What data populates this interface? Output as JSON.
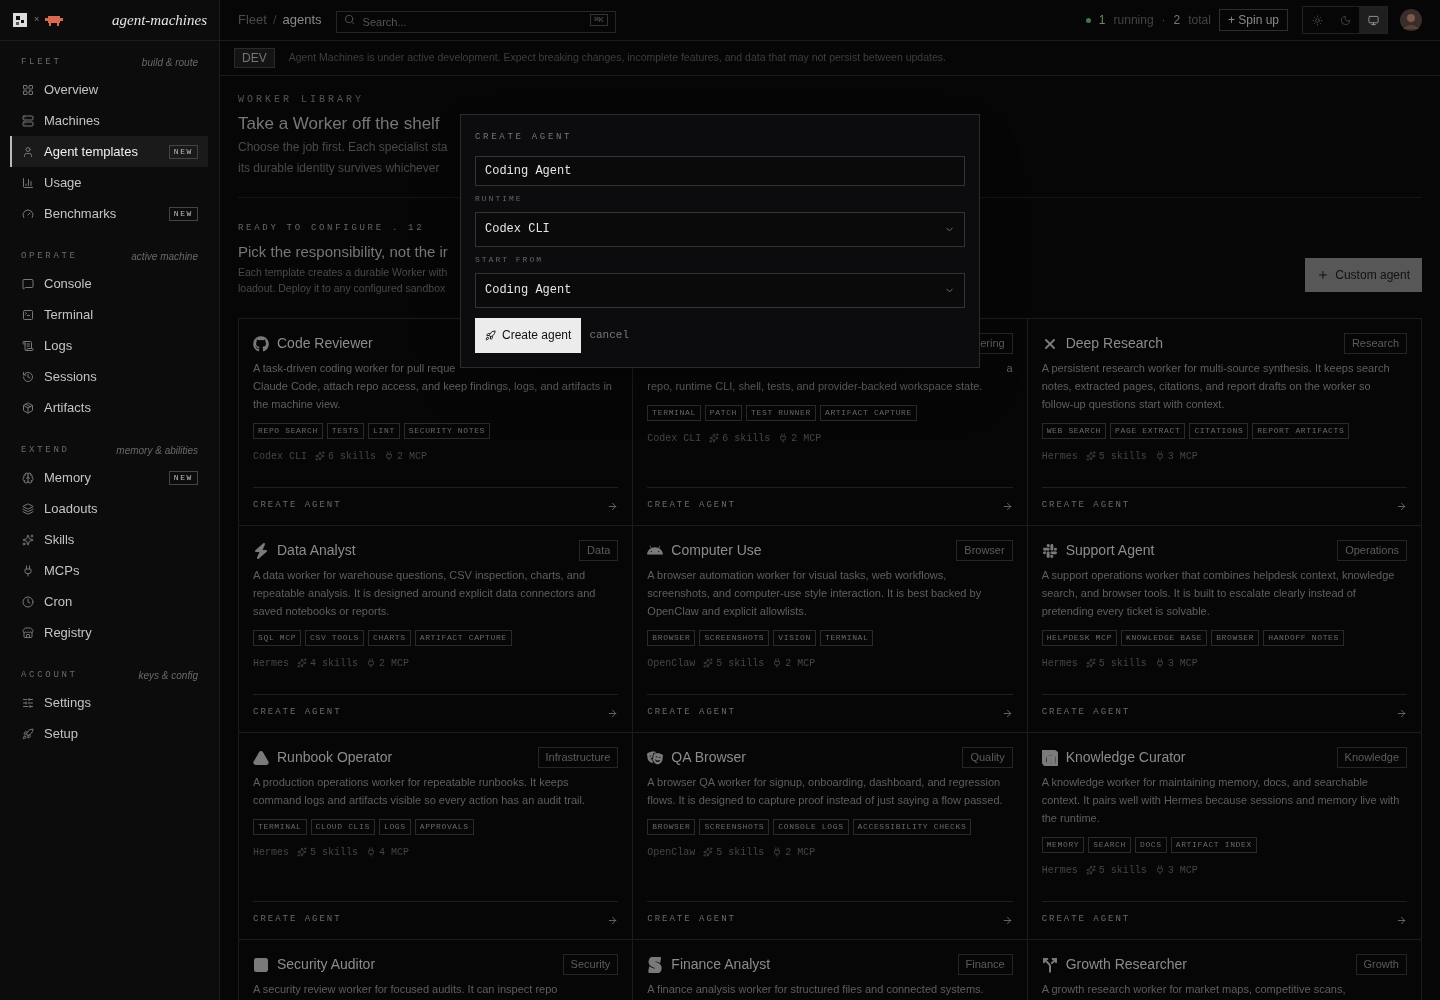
{
  "brand": {
    "separator": "×",
    "name": "agent-machines"
  },
  "breadcrumb": [
    "Fleet",
    "/",
    "agents"
  ],
  "search": {
    "placeholder": "Search...",
    "shortcut": "⌘K"
  },
  "status": {
    "running_count": "1",
    "running_label": "running",
    "dot": "·",
    "total_count": "2",
    "total_label": "total"
  },
  "spin_up_button": "+ Spin up",
  "theme_buttons": [
    {
      "kind": "light",
      "selected": false
    },
    {
      "kind": "dark",
      "selected": false
    },
    {
      "kind": "system",
      "selected": true
    }
  ],
  "sidebar": [
    {
      "label": "FLEET",
      "hint": "build & route",
      "items": [
        {
          "label": "Overview",
          "selected": false
        },
        {
          "label": "Machines",
          "selected": false
        },
        {
          "label": "Agent templates",
          "selected": true,
          "badge": "NEW"
        },
        {
          "label": "Usage",
          "selected": false
        },
        {
          "label": "Benchmarks",
          "selected": false,
          "badge": "NEW"
        }
      ]
    },
    {
      "label": "OPERATE",
      "hint": "active machine",
      "items": [
        {
          "label": "Console",
          "selected": false
        },
        {
          "label": "Terminal",
          "selected": false
        },
        {
          "label": "Logs",
          "selected": false
        },
        {
          "label": "Sessions",
          "selected": false
        },
        {
          "label": "Artifacts",
          "selected": false
        }
      ]
    },
    {
      "label": "EXTEND",
      "hint": "memory & abilities",
      "items": [
        {
          "label": "Memory",
          "selected": false,
          "badge": "NEW"
        },
        {
          "label": "Loadouts",
          "selected": false
        },
        {
          "label": "Skills",
          "selected": false
        },
        {
          "label": "MCPs",
          "selected": false
        },
        {
          "label": "Cron",
          "selected": false
        },
        {
          "label": "Registry",
          "selected": false
        }
      ]
    },
    {
      "label": "ACCOUNT",
      "hint": "keys & config",
      "items": [
        {
          "label": "Settings",
          "selected": false
        },
        {
          "label": "Setup",
          "selected": false
        }
      ]
    }
  ],
  "banner": {
    "badge": "DEV",
    "text": "Agent Machines is under active development. Expect breaking changes, incomplete features, and data that may not persist between updates."
  },
  "library": {
    "eyebrow": "WORKER LIBRARY",
    "title": "Take a Worker off the shelf",
    "lines": [
      "Choose the job first. Each specialist sta",
      "its durable identity survives whichever"
    ]
  },
  "section": {
    "eyebrow": "READY TO CONFIGURE . 12",
    "title": "Pick the responsibility, not the ir",
    "lines": [
      "Each template creates a durable Worker with",
      "loadout. Deploy it to any configured sandbox"
    ],
    "button": "Custom agent"
  },
  "cards": [
    {
      "title": "Code Reviewer",
      "description": [
        {
          "kind": "full",
          "text": "A task-driven coding worker for pull reque"
        },
        {
          "kind": "full",
          "text": "Claude Code, attach repo access, and keep findings, logs, and artifacts in"
        },
        {
          "kind": "full",
          "text": "the machine view."
        }
      ],
      "tags": [
        "REPO SEARCH",
        "TESTS",
        "LINT",
        "SECURITY NOTES"
      ],
      "runtime": "Codex CLI",
      "skills": "6 skills",
      "mcp": "2 MCP",
      "action": "CREATE AGENT"
    },
    {
      "badge": "ering",
      "description": [
        {
          "kind": "tail",
          "text": "a"
        },
        {
          "kind": "full",
          "text": "repo, runtime CLI, shell, tests, and provider-backed workspace state."
        }
      ],
      "tags": [
        "TERMINAL",
        "PATCH",
        "TEST RUNNER",
        "ARTIFACT CAPTURE"
      ],
      "runtime": "Codex CLI",
      "skills": "6 skills",
      "mcp": "2 MCP",
      "action": "CREATE AGENT"
    },
    {
      "title": "Deep Research",
      "badge": "Research",
      "description": "A persistent research worker for multi-source synthesis. It keeps search notes, extracted pages, citations, and report drafts on the worker so follow-up questions start with context.",
      "tags": [
        "WEB SEARCH",
        "PAGE EXTRACT",
        "CITATIONS",
        "REPORT ARTIFACTS"
      ],
      "runtime": "Hermes",
      "skills": "5 skills",
      "mcp": "3 MCP",
      "action": "CREATE AGENT"
    },
    {
      "title": "Data Analyst",
      "badge": "Data",
      "description": "A data worker for warehouse questions, CSV inspection, charts, and repeatable analysis. It is designed around explicit data connectors and saved notebooks or reports.",
      "tags": [
        "SQL MCP",
        "CSV TOOLS",
        "CHARTS",
        "ARTIFACT CAPTURE"
      ],
      "runtime": "Hermes",
      "skills": "4 skills",
      "mcp": "2 MCP",
      "action": "CREATE AGENT"
    },
    {
      "title": "Computer Use",
      "badge": "Browser",
      "description": "A browser automation worker for visual tasks, web workflows, screenshots, and computer-use style interaction. It is best backed by OpenClaw and explicit allowlists.",
      "tags": [
        "BROWSER",
        "SCREENSHOTS",
        "VISION",
        "TERMINAL"
      ],
      "runtime": "OpenClaw",
      "skills": "5 skills",
      "mcp": "2 MCP",
      "action": "CREATE AGENT"
    },
    {
      "title": "Support Agent",
      "badge": "Operations",
      "description": "A support operations worker that combines helpdesk context, knowledge search, and browser tools. It is built to escalate clearly instead of pretending every ticket is solvable.",
      "tags": [
        "HELPDESK MCP",
        "KNOWLEDGE BASE",
        "BROWSER",
        "HANDOFF NOTES"
      ],
      "runtime": "Hermes",
      "skills": "5 skills",
      "mcp": "3 MCP",
      "action": "CREATE AGENT"
    },
    {
      "title": "Runbook Operator",
      "badge": "Infrastructure",
      "description": "A production operations worker for repeatable runbooks. It keeps command logs and artifacts visible so every action has an audit trail.",
      "tags": [
        "TERMINAL",
        "CLOUD CLIS",
        "LOGS",
        "APPROVALS"
      ],
      "runtime": "Hermes",
      "skills": "5 skills",
      "mcp": "4 MCP",
      "action": "CREATE AGENT"
    },
    {
      "title": "QA Browser",
      "badge": "Quality",
      "description": "A browser QA worker for signup, onboarding, dashboard, and regression flows. It is designed to capture proof instead of just saying a flow passed.",
      "tags": [
        "BROWSER",
        "SCREENSHOTS",
        "CONSOLE LOGS",
        "ACCESSIBILITY CHECKS"
      ],
      "runtime": "OpenClaw",
      "skills": "5 skills",
      "mcp": "2 MCP",
      "action": "CREATE AGENT"
    },
    {
      "title": "Knowledge Curator",
      "badge": "Knowledge",
      "description": "A knowledge worker for maintaining memory, docs, and searchable context. It pairs well with Hermes because sessions and memory live with the runtime.",
      "tags": [
        "MEMORY",
        "SEARCH",
        "DOCS",
        "ARTIFACT INDEX"
      ],
      "runtime": "Hermes",
      "skills": "5 skills",
      "mcp": "3 MCP",
      "action": "CREATE AGENT"
    },
    {
      "title": "Security Auditor",
      "badge": "Security",
      "description": "A security review worker for focused audits. It can inspect repo"
    },
    {
      "title": "Finance Analyst",
      "badge": "Finance",
      "description": "A finance analysis worker for structured files and connected systems."
    },
    {
      "title": "Growth Researcher",
      "badge": "Growth",
      "description": "A growth research worker for market maps, competitive scans,"
    }
  ],
  "modal": {
    "title": "CREATE AGENT",
    "name_value": "Coding Agent",
    "runtime_label": "RUNTIME",
    "runtime_value": "Codex CLI",
    "start_label": "START FROM",
    "start_value": "Coding Agent",
    "submit": "Create agent",
    "cancel": "cancel"
  }
}
